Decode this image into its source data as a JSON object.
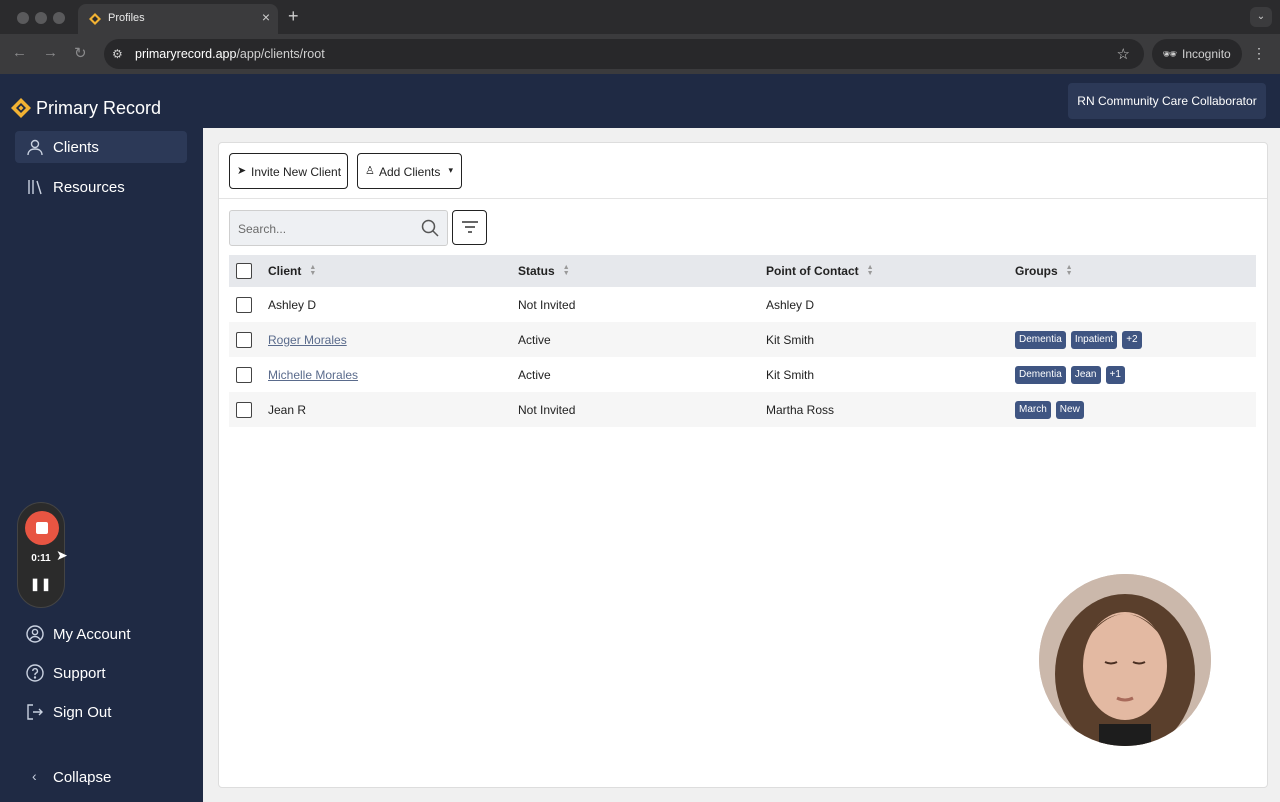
{
  "browser": {
    "tab_title": "Profiles",
    "url_host": "primaryrecord.app",
    "url_path": "/app/clients/root",
    "incognito_label": "Incognito"
  },
  "app": {
    "brand": "Primary Record",
    "role_badge": "RN Community Care Collaborator",
    "brand_color": "#1f2a44",
    "accent_color": "#f2b233"
  },
  "sidebar": {
    "items": [
      {
        "label": "Clients",
        "icon": "user-icon"
      },
      {
        "label": "Resources",
        "icon": "library-icon"
      }
    ],
    "bottom_items": [
      {
        "label": "My Account",
        "icon": "account-icon"
      },
      {
        "label": "Support",
        "icon": "help-icon"
      },
      {
        "label": "Sign Out",
        "icon": "sign-out-icon"
      }
    ],
    "collapse_label": "Collapse"
  },
  "recorder": {
    "time": "0:11"
  },
  "toolbar": {
    "invite_label": "Invite New Client",
    "add_label": "Add Clients"
  },
  "search": {
    "placeholder": "Search..."
  },
  "table": {
    "headers": [
      "Client",
      "Status",
      "Point of Contact",
      "Groups"
    ],
    "rows": [
      {
        "client": "Ashley D",
        "linked": false,
        "status": "Not Invited",
        "contact": "Ashley D",
        "groups": []
      },
      {
        "client": "Roger Morales",
        "linked": true,
        "status": "Active",
        "contact": "Kit Smith",
        "groups": [
          "Dementia",
          "Inpatient",
          "+2"
        ]
      },
      {
        "client": "Michelle Morales",
        "linked": true,
        "status": "Active",
        "contact": "Kit Smith",
        "groups": [
          "Dementia",
          "Jean",
          "+1"
        ]
      },
      {
        "client": "Jean R",
        "linked": false,
        "status": "Not Invited",
        "contact": "Martha Ross",
        "groups": [
          "March",
          "New"
        ]
      }
    ]
  }
}
